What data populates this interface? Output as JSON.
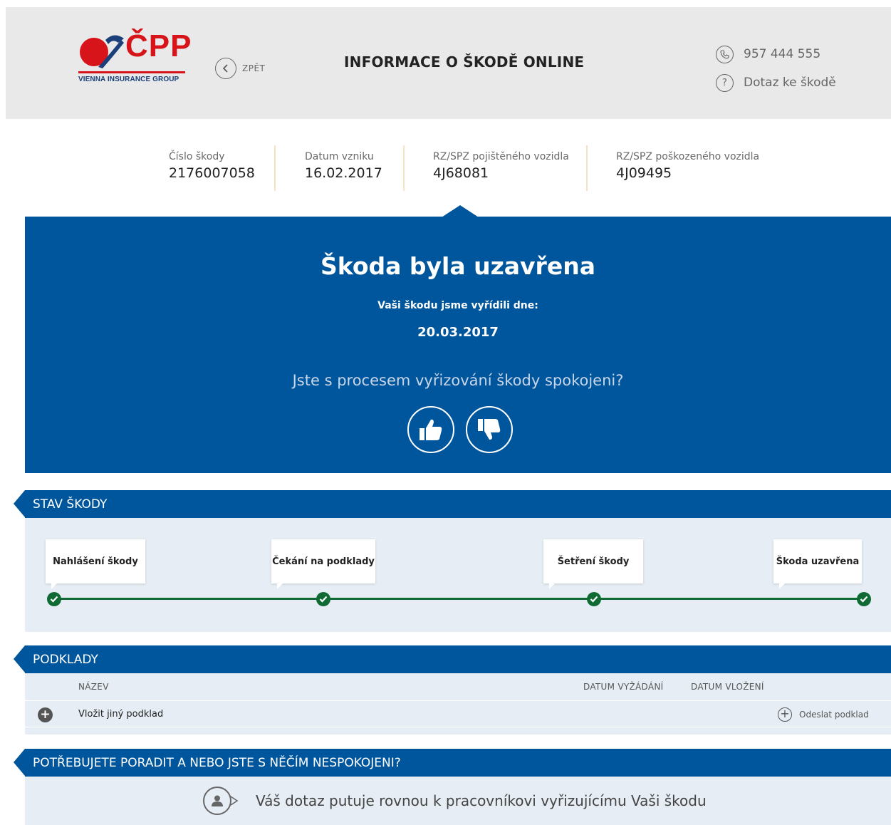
{
  "header": {
    "logo_text": "ČPP",
    "logo_subtitle": "VIENNA INSURANCE GROUP",
    "back_label": "ZPĚT",
    "title": "INFORMACE O ŠKODĚ ONLINE",
    "phone": "957 444 555",
    "question_link": "Dotaz ke škodě"
  },
  "claim_info": [
    {
      "label": "Číslo škody",
      "value": "2176007058"
    },
    {
      "label": "Datum vzniku",
      "value": "16.02.2017"
    },
    {
      "label": "RZ/SPZ pojištěného vozidla",
      "value": "4J68081"
    },
    {
      "label": "RZ/SPZ poškozeného vozidla",
      "value": "4J09495"
    }
  ],
  "status": {
    "title": "Škoda byla uzavřena",
    "subtitle": "Vaši škodu jsme vyřídili dne:",
    "date": "20.03.2017",
    "question": "Jste s procesem vyřizování škody spokojeni?"
  },
  "progress": {
    "heading": "STAV ŠKODY",
    "steps": [
      {
        "label": "Nahlášení škody"
      },
      {
        "label": "Čekání na podklady"
      },
      {
        "label": "Šetření škody"
      },
      {
        "label": "Škoda uzavřena"
      }
    ]
  },
  "documents": {
    "heading": "PODKLADY",
    "columns": {
      "name": "NÁZEV",
      "requested": "DATUM VYŽÁDÁNÍ",
      "inserted": "DATUM VLOŽENÍ"
    },
    "rows": [
      {
        "name": "Vložit jiný podklad",
        "action": "Odeslat podklad"
      }
    ]
  },
  "help": {
    "heading": "POTŘEBUJETE PORADIT A NEBO JSTE S NĚČÍM NESPOKOJENI?",
    "text": "Váš dotaz putuje rovnou k pracovníkovi vyřizujícímu Vaši škodu"
  },
  "colors": {
    "brand_blue": "#00569c",
    "brand_red": "#d7141a",
    "progress_green": "#0f6b33",
    "section_bg": "#e6edf4"
  }
}
